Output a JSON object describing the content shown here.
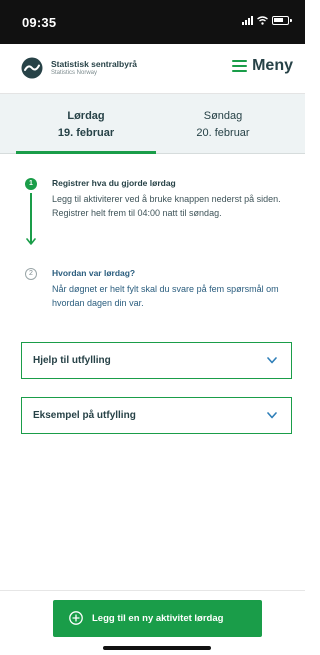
{
  "status_bar": {
    "time": "09:35"
  },
  "header": {
    "brand_name": "Statistisk sentralbyrå",
    "brand_sub": "Statistics Norway",
    "menu_label": "Meny",
    "accent_color": "#1a9d49"
  },
  "day_tabs": [
    {
      "day": "Lørdag",
      "date": "19. februar",
      "active": true
    },
    {
      "day": "Søndag",
      "date": "20. februar",
      "active": false
    }
  ],
  "steps": [
    {
      "marker": "1",
      "title": "Registrer hva du gjorde lørdag",
      "text": "Legg til aktiviterer ved å bruke knappen nederst på siden. Registrer helt frem til 04:00 natt til søndag.",
      "state": "current"
    },
    {
      "marker": "2",
      "title": "Hvordan var lørdag?",
      "text": "Når døgnet er helt fylt skal du svare på fem spørsmål om hvordan dagen din var.",
      "state": "upcoming"
    }
  ],
  "accordions": [
    {
      "label": "Hjelp til utfylling",
      "icon": "chevron-down-icon"
    },
    {
      "label": "Eksempel på utfylling",
      "icon": "chevron-down-icon"
    }
  ],
  "add_button": {
    "label": "Legg til en ny aktivitet lørdag",
    "icon": "plus-circle-icon"
  }
}
